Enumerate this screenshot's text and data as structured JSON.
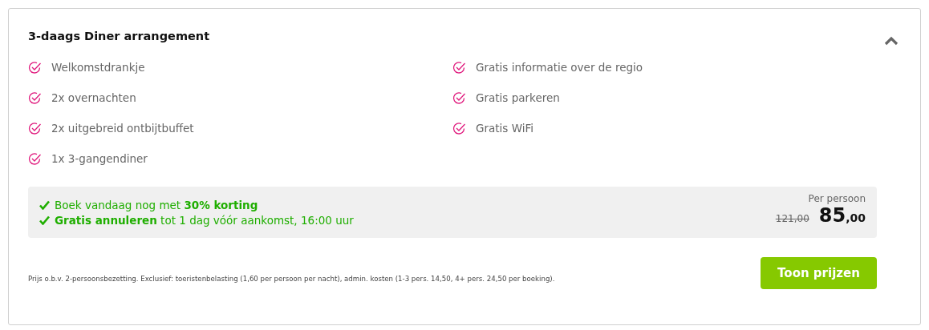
{
  "package": {
    "title": "3-daags Diner arrangement",
    "expanded": true,
    "features_left": [
      "Welkomstdrankje",
      "2x overnachten",
      "2x uitgebreid ontbijtbuffet",
      "1x 3-gangendiner"
    ],
    "features_right": [
      "Gratis informatie over de regio",
      "Gratis parkeren",
      "Gratis WiFi"
    ],
    "offers": [
      "Boek vandaag nog met **30% korting**",
      "**Gratis annuleren** tot 1 dag vóór aankomst, 16:00 uur"
    ],
    "price": {
      "label": "Per persoon",
      "old": "121,00",
      "main": "85",
      "cents": ",00"
    },
    "footnote": "Prijs o.b.v. 2-persoonsbezetting. Exclusief: toeristenbelasting (1,60 per persoon per nacht), admin. kosten (1-3 pers. 14,50, 4+ pers. 24,50 per boeking).",
    "button": "Toon prijzen"
  }
}
